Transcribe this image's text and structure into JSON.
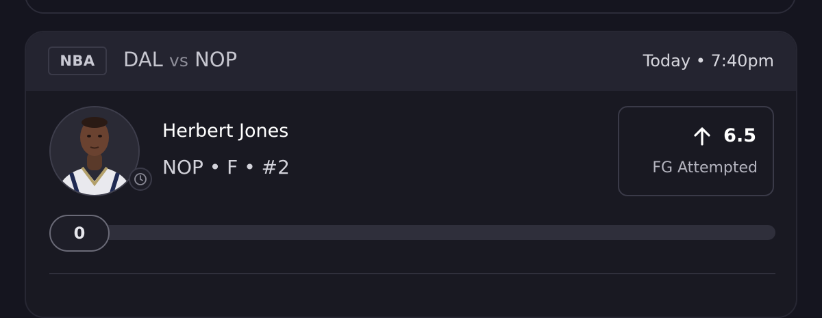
{
  "header": {
    "league": "NBA",
    "home_team": "DAL",
    "vs_label": "vs",
    "away_team": "NOP",
    "game_time": "Today • 7:40pm"
  },
  "player": {
    "name": "Herbert Jones",
    "meta": "NOP • F • #2",
    "avatar_icon": "player-headshot",
    "status_icon": "clock-icon"
  },
  "pick": {
    "direction_icon": "arrow-up-icon",
    "line": "6.5",
    "stat": "FG Attempted"
  },
  "progress": {
    "current": "0",
    "current_value": 0,
    "target": 6.5
  },
  "colors": {
    "background": "#15151f",
    "card": "#191922",
    "header": "#242430",
    "track": "#2f2f3b",
    "border": "#3a3a48"
  }
}
